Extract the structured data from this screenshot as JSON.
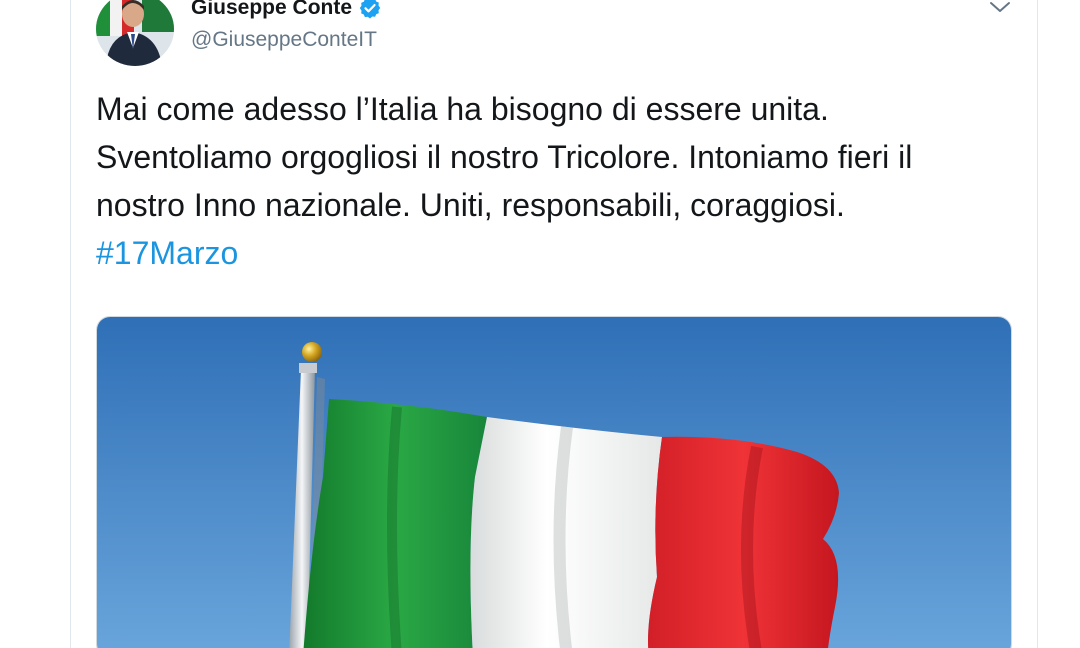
{
  "author": {
    "name": "Giuseppe Conte",
    "handle": "@GiuseppeConteIT",
    "verified": true,
    "verified_icon": "verified-badge-icon"
  },
  "tweet": {
    "text_before_hashtag": "Mai come adesso l’Italia ha bisogno di essere unita. Sventoliamo orgogliosi il nostro Tricolore. Intoniamo fieri il nostro Inno nazionale. Uniti, responsabili, coraggiosi. ",
    "hashtag": "#17Marzo"
  },
  "media": {
    "description_icon": "italian-flag-photo"
  },
  "menu": {
    "icon": "chevron-down-icon"
  },
  "colors": {
    "name_text": "#14171a",
    "handle_text": "#657786",
    "hashtag": "#1b95e0",
    "verified": "#1da1f2",
    "flag_green": "#1f9b3a",
    "flag_white": "#f4f5f4",
    "flag_red": "#e0242a",
    "sky": "#3f86c9"
  }
}
